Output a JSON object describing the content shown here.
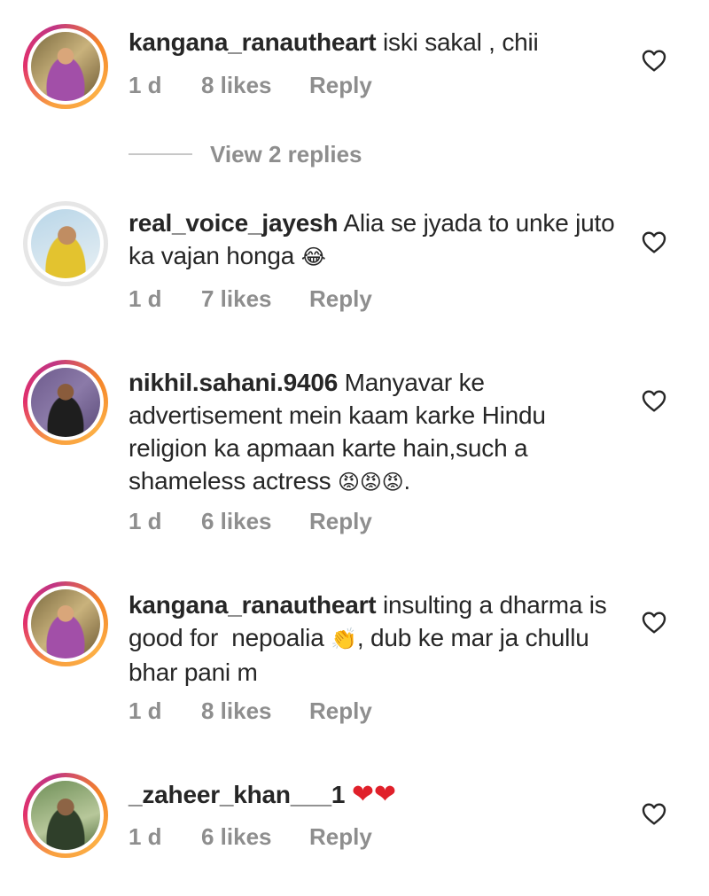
{
  "comments": [
    {
      "username": "kangana_ranautheart",
      "text": " iski sakal , chii",
      "emoji": "",
      "time": "1 d",
      "likes": "8 likes",
      "reply": "Reply",
      "view_replies": "View 2 replies",
      "avatar_ring": true
    },
    {
      "username": "real_voice_jayesh",
      "text": " Alia se jyada to unke juto ka vajan honga ",
      "emoji": "😂",
      "time": "1 d",
      "likes": "7 likes",
      "reply": "Reply",
      "avatar_ring": false
    },
    {
      "username": "nikhil.sahani.9406",
      "text": " Manyavar ke advertisement mein kaam karke Hindu religion ka apmaan karte hain,such a shameless actress ",
      "emoji": "😡😡😡.",
      "time": "1 d",
      "likes": "6 likes",
      "reply": "Reply",
      "avatar_ring": true
    },
    {
      "username": "kangana_ranautheart",
      "text": " insulting a dharma is good for  nepoalia ",
      "emoji": "👏",
      "text_after": ", dub ke mar ja chullu bhar pani m",
      "time": "1 d",
      "likes": "8 likes",
      "reply": "Reply",
      "avatar_ring": true
    },
    {
      "username": "_zaheer_khan___1",
      "text": " ",
      "emoji": "❤❤",
      "time": "1 d",
      "likes": "6 likes",
      "reply": "Reply",
      "avatar_ring": true
    }
  ],
  "colors": {
    "text": "#262626",
    "meta": "#8e8e8e",
    "heart_emoji": "#e0202a"
  },
  "icons": {
    "like": "heart-outline-icon"
  }
}
